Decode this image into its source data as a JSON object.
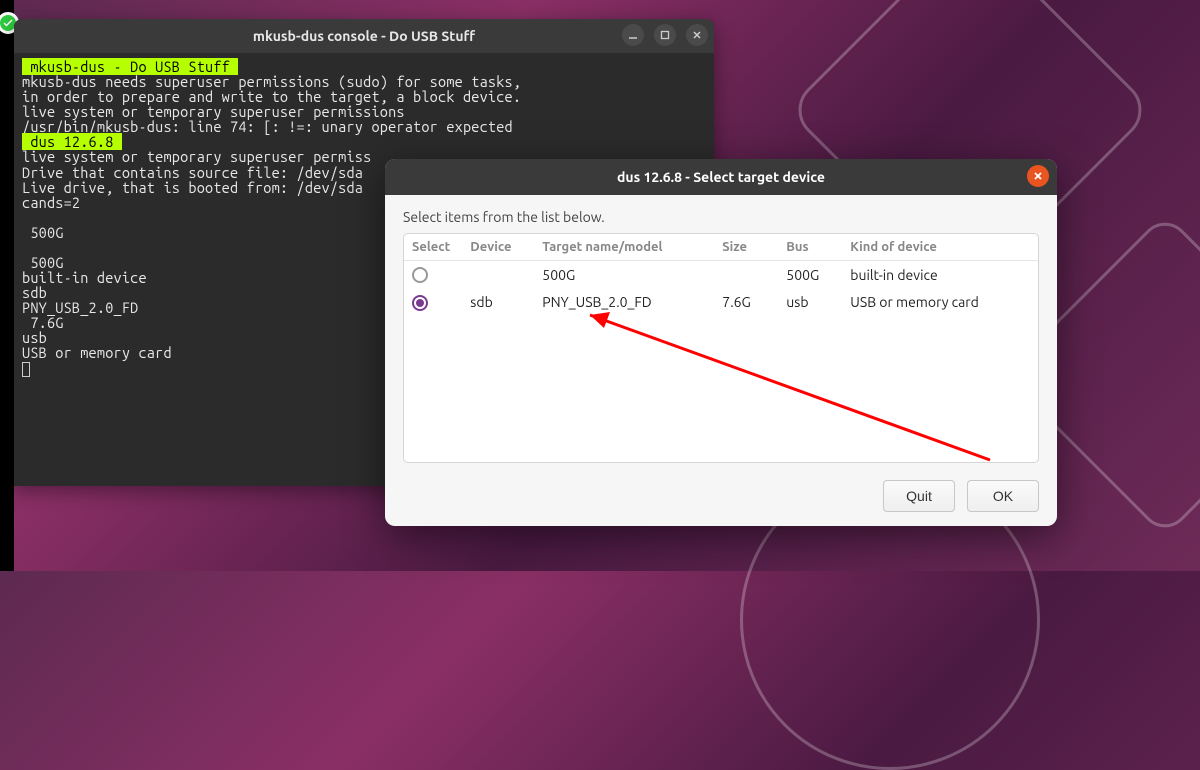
{
  "terminal": {
    "title": "mkusb-dus console - Do USB Stuff",
    "hl1": " mkusb-dus - Do USB Stuff ",
    "l1": "mkusb-dus needs superuser permissions (sudo) for some tasks,",
    "l2": "in order to prepare and write to the target, a block device.",
    "l3": "live system or temporary superuser permissions",
    "l4": "/usr/bin/mkusb-dus: line 74: [: !=: unary operator expected",
    "hl2": " dus 12.6.8 ",
    "l5": "live system or temporary superuser permiss",
    "l6": "Drive that contains source file: /dev/sda",
    "l7": "Live drive, that is booted from: /dev/sda",
    "l8": "cands=2",
    "l9": "",
    "l10": " 500G",
    "l11": "",
    "l12": " 500G",
    "l13": "built-in device",
    "l14": "sdb",
    "l15": "PNY_USB_2.0_FD",
    "l16": " 7.6G",
    "l17": "usb",
    "l18": "USB or memory card"
  },
  "dialog": {
    "title": "dus 12.6.8 - Select target device",
    "instruction": "Select items from the list below.",
    "columns": {
      "select": "Select",
      "device": "Device",
      "target": "Target name/model",
      "size": "Size",
      "bus": "Bus",
      "kind": "Kind of device"
    },
    "rows": [
      {
        "selected": false,
        "device": "",
        "target": "500G",
        "size": "",
        "bus": "500G",
        "kind": "built-in device"
      },
      {
        "selected": true,
        "device": "sdb",
        "target": "PNY_USB_2.0_FD",
        "size": "7.6G",
        "bus": "usb",
        "kind": "USB or memory card"
      }
    ],
    "quit_label": "Quit",
    "ok_label": "OK"
  }
}
